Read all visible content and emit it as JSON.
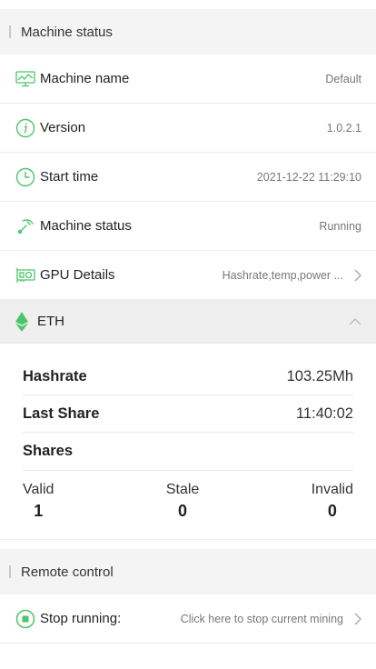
{
  "machine_status": {
    "title": "Machine status",
    "rows": [
      {
        "icon": "monitor-icon",
        "label": "Machine name",
        "value": "Default"
      },
      {
        "icon": "info-icon",
        "label": "Version",
        "value": "1.0.2.1"
      },
      {
        "icon": "clock-icon",
        "label": "Start time",
        "value": "2021-12-22 11:29:10"
      },
      {
        "icon": "pickaxe-icon",
        "label": "Machine status",
        "value": "Running"
      },
      {
        "icon": "gpu-icon",
        "label": "GPU Details",
        "value": "Hashrate,temp,power ..."
      }
    ]
  },
  "coin": {
    "name": "ETH",
    "icon": "ethereum-icon",
    "hashrate_label": "Hashrate",
    "hashrate_value": "103.25Mh",
    "last_share_label": "Last Share",
    "last_share_value": "11:40:02",
    "shares_title": "Shares",
    "shares": [
      {
        "label": "Valid",
        "count": "1"
      },
      {
        "label": "Stale",
        "count": "0"
      },
      {
        "label": "Invalid",
        "count": "0"
      }
    ]
  },
  "remote_control": {
    "title": "Remote control",
    "stop_label": "Stop running:",
    "stop_hint": "Click here to stop current mining"
  },
  "colors": {
    "accent_green": "#4cc66a",
    "section_bg": "#f4f4f4"
  }
}
